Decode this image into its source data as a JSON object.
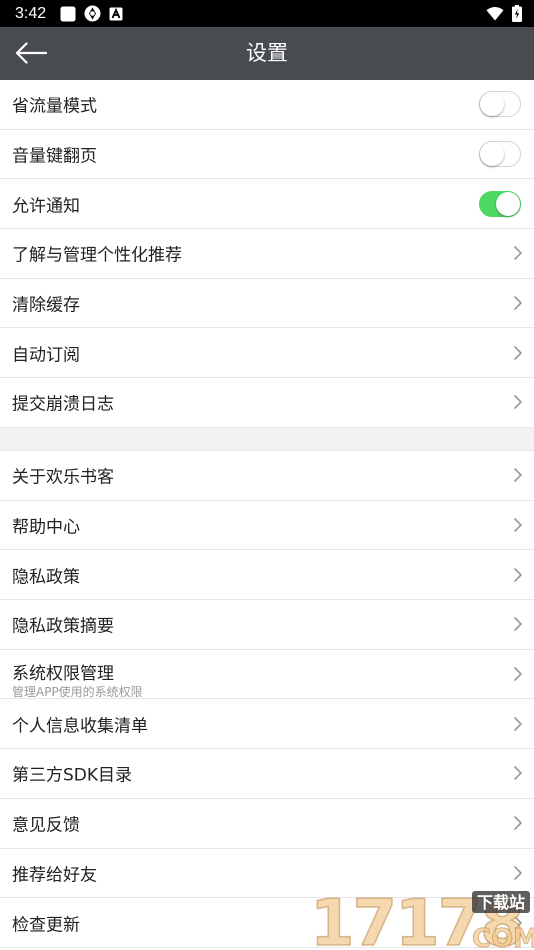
{
  "status_bar": {
    "time": "3:42",
    "icons_left": [
      "square-app-icon",
      "shutter-app-icon",
      "font-a-icon"
    ],
    "icons_right": [
      "wifi-icon",
      "battery-charging-icon"
    ]
  },
  "header": {
    "title": "设置",
    "back_icon": "back-arrow-icon",
    "background_color": "#484b4f"
  },
  "group1": [
    {
      "label": "省流量模式",
      "control": "toggle",
      "on": false
    },
    {
      "label": "音量键翻页",
      "control": "toggle",
      "on": false
    },
    {
      "label": "允许通知",
      "control": "toggle",
      "on": true
    },
    {
      "label": "了解与管理个性化推荐",
      "control": "chevron"
    },
    {
      "label": "清除缓存",
      "control": "chevron"
    },
    {
      "label": "自动订阅",
      "control": "chevron"
    },
    {
      "label": "提交崩溃日志",
      "control": "chevron"
    }
  ],
  "group2": [
    {
      "label": "关于欢乐书客",
      "control": "chevron"
    },
    {
      "label": "帮助中心",
      "control": "chevron"
    },
    {
      "label": "隐私政策",
      "control": "chevron"
    },
    {
      "label": "隐私政策摘要",
      "control": "chevron"
    },
    {
      "label": "系统权限管理",
      "sub": "管理APP使用的系统权限",
      "control": "chevron"
    },
    {
      "label": "个人信息收集清单",
      "control": "chevron"
    },
    {
      "label": "第三方SDK目录",
      "control": "chevron"
    },
    {
      "label": "意见反馈",
      "control": "chevron"
    },
    {
      "label": "推荐给好友",
      "control": "chevron"
    },
    {
      "label": "检查更新",
      "control": "chevron"
    }
  ],
  "colors": {
    "toggle_on": "#4cd964",
    "section_gap": "#f2f2f2",
    "divider": "#e6e6e6"
  },
  "watermark": {
    "number": "17178",
    "badge": "下载站",
    "suffix": "COM"
  }
}
